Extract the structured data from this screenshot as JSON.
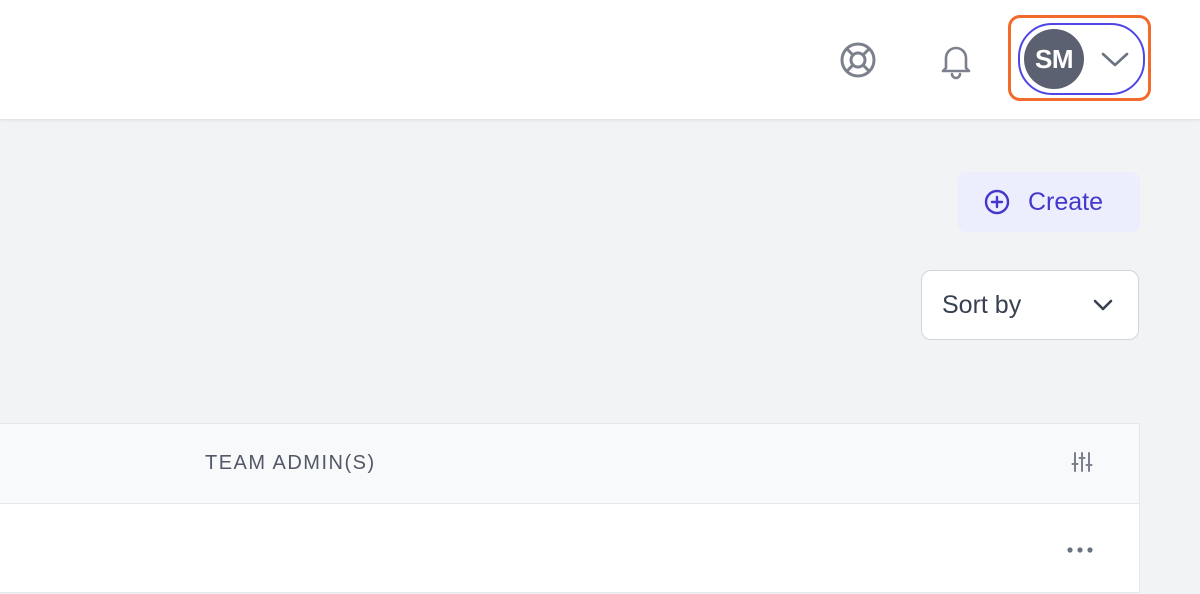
{
  "header": {
    "help_icon": "lifebuoy-icon",
    "notifications_icon": "bell-icon",
    "user": {
      "initials": "SM",
      "menu_icon": "chevron-down-icon"
    }
  },
  "toolbar": {
    "create_label": "Create",
    "create_icon": "plus-circle-icon",
    "sort_label": "Sort by",
    "sort_icon": "chevron-down-icon"
  },
  "table": {
    "columns": [
      "TEAM ADMIN(S)"
    ],
    "column_settings_icon": "sliders-icon",
    "rows": [
      {
        "actions_icon": "more-horizontal-icon"
      }
    ]
  },
  "colors": {
    "accent": "#4f46e5",
    "highlight": "#f26b2c",
    "avatar_bg": "#5b6170",
    "create_bg": "#eceefe"
  }
}
